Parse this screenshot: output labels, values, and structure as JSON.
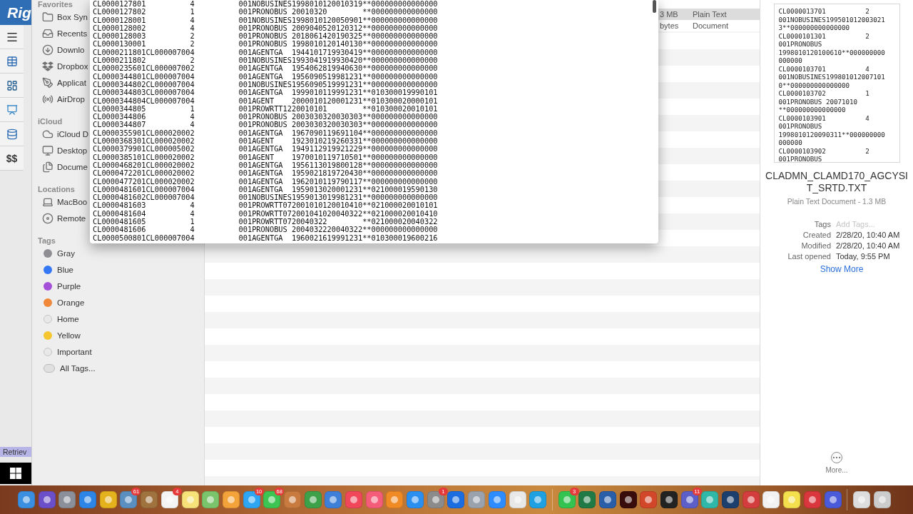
{
  "left_strip": {
    "logo": "Rig",
    "dollar_label": "$$",
    "retrieve_label": "Retriev"
  },
  "sidebar": {
    "sections": [
      {
        "title": "Favorites",
        "items": [
          {
            "label": "Box Syn",
            "kind": "folder"
          },
          {
            "label": "Recents",
            "kind": "recents"
          },
          {
            "label": "Downlo",
            "kind": "download"
          },
          {
            "label": "Dropbox",
            "kind": "dropbox"
          },
          {
            "label": "Applicat",
            "kind": "apps"
          },
          {
            "label": "AirDrop",
            "kind": "airdrop"
          }
        ]
      },
      {
        "title": "iCloud",
        "items": [
          {
            "label": "iCloud D",
            "kind": "cloud"
          },
          {
            "label": "Desktop",
            "kind": "desktop"
          },
          {
            "label": "Docume",
            "kind": "document"
          }
        ]
      },
      {
        "title": "Locations",
        "items": [
          {
            "label": "MacBoo",
            "kind": "laptop"
          },
          {
            "label": "Remote",
            "kind": "disc"
          }
        ]
      },
      {
        "title": "Tags",
        "items": [
          {
            "label": "Gray",
            "kind": "tag",
            "color": "#8e8e93"
          },
          {
            "label": "Blue",
            "kind": "tag",
            "color": "#3478f6"
          },
          {
            "label": "Purple",
            "kind": "tag",
            "color": "#a550d8"
          },
          {
            "label": "Orange",
            "kind": "tag",
            "color": "#f0883a"
          },
          {
            "label": "Home",
            "kind": "tag-empty"
          },
          {
            "label": "Yellow",
            "kind": "tag",
            "color": "#f5c62f"
          },
          {
            "label": "Important",
            "kind": "tag-empty"
          },
          {
            "label": "All Tags...",
            "kind": "all-tags"
          }
        ]
      }
    ]
  },
  "file_list": {
    "rows": [
      {
        "size": "3 MB",
        "file_kind": "Plain Text",
        "selected": true
      },
      {
        "size": "bytes",
        "file_kind": "Document",
        "selected": false
      }
    ]
  },
  "quick_look": {
    "lines": [
      "CL0000127801          4          001NOBUSINES1998010120010319**000000000000000",
      "CL0000127802          1          001PRONOBUS 20010320        **000000000000000",
      "CL0000128001          4          001NOBUSINES1998010120050901**000000000000000",
      "CL0000128002          4          001PRONOBUS 2009040520120312**000000000000000",
      "CL0000128003          2          001PRONOBUS 2018061420190325**000000000000000",
      "CL0000130001          2          001PRONOBUS 1998010120140130**000000000000000",
      "CL0000211801CL000007004          001AGENTGA  1944101719930419**000000000000000",
      "CL0000211802          2          001NOBUSINES1993041919930420**000000000000000",
      "CL0000235601CL000007002          001AGENTGA  1954062819940630**000000000000000",
      "CL0000344801CL000007004          001AGENTGA  1956090519981231**000000000000000",
      "CL0000344802CL000007004          001NOBUSINES1956090519991231**000000000000000",
      "CL0000344803CL000007004          001AGENTGA  1999010119991231**010300019990101",
      "CL0000344804CL000007004          001AGENT    2000010120001231**010300020000101",
      "CL0000344805          1          001PROWRTT1220010101        **010300020010101",
      "CL0000344806          4          001PRONOBUS 2003030320030303**000000000000000",
      "CL0000344807          4          001PRONOBUS 2003030320030303**000000000000000",
      "CL0000355901CL000020002          001AGENTGA  1967090119691104**000000000000000",
      "CL0000368301CL000020002          001AGENT    1923010219260331**000000000000000",
      "CL0000379901CL000005002          001AGENTGA  1949112919921229**000000000000000",
      "CL0000385101CL000020002          001AGENT    1970010119710501**000000000000000",
      "CL0000468201CL000020002          001AGENTGA  1956113019800128**000000000000000",
      "CL0000472201CL000020002          001AGENTGA  1959021819720430**000000000000000",
      "CL0000477201CL000020002          001AGENTGA  1962010119790117**000000000000000",
      "CL0000481601CL000007004          001AGENTGA  1959013020001231**021000019590130",
      "CL0000481602CL000007004          001NOBUSINES1959013019981231**000000000000000",
      "CL0000481603          4          001PROWRTT072001010120010410**021000020010101",
      "CL0000481604          4          001PROWRTT072001041020040322**021000020010410",
      "CL0000481605          1          001PROWRTT0720040322        **021000020040322",
      "CL0000481606          4          001PRONOBUS 2004032220040322**000000000000000",
      "CL0000500801CL000007004          001AGENTGA  1960021619991231**010300019600216"
    ]
  },
  "preview": {
    "lines": [
      "CL0000013701          2",
      "001NOBUSINES199501012003021",
      "3**000000000000000",
      "CL0000101301          2",
      "001PRONOBUS",
      "1998010120100610**000000000",
      "000000",
      "CL0000103701          4",
      "001NOBUSINES199801012007101",
      "0**000000000000000",
      "CL0000103702          1",
      "001PRONOBUS 20071010",
      "**000000000000000",
      "CL0000103901          4",
      "001PRONOBUS",
      "1998010120090311**000000000",
      "000000",
      "CL0000103902          2",
      "001PRONOBUS"
    ],
    "filename": "CLADMN_CLAMD170_AGCYSIT_SRTD.TXT",
    "subtitle": "Plain Text Document - 1.3 MB",
    "meta": [
      {
        "label": "Tags",
        "placeholder": "Add Tags..."
      },
      {
        "label": "Created",
        "value": "2/28/20, 10:40 AM"
      },
      {
        "label": "Modified",
        "value": "2/28/20, 10:40 AM"
      },
      {
        "label": "Last opened",
        "value": "Today, 9:55 PM"
      }
    ],
    "show_more": "Show More",
    "more": "More..."
  },
  "dock": {
    "items": [
      {
        "kind": "app"
      },
      {
        "kind": "app"
      },
      {
        "kind": "app"
      },
      {
        "kind": "app"
      },
      {
        "kind": "app"
      },
      {
        "kind": "app",
        "badge": "61"
      },
      {
        "kind": "app"
      },
      {
        "kind": "app",
        "badge": "4"
      },
      {
        "kind": "app"
      },
      {
        "kind": "app"
      },
      {
        "kind": "app"
      },
      {
        "kind": "app",
        "badge": "10"
      },
      {
        "kind": "app",
        "badge": "68"
      },
      {
        "kind": "app"
      },
      {
        "kind": "app"
      },
      {
        "kind": "app"
      },
      {
        "kind": "app"
      },
      {
        "kind": "app"
      },
      {
        "kind": "app"
      },
      {
        "kind": "app"
      },
      {
        "kind": "app",
        "badge": "1"
      },
      {
        "kind": "app"
      },
      {
        "kind": "app"
      },
      {
        "kind": "app"
      },
      {
        "kind": "app"
      },
      {
        "kind": "app"
      },
      {
        "kind": "separator"
      },
      {
        "kind": "app",
        "badge": "3"
      },
      {
        "kind": "app"
      },
      {
        "kind": "app"
      },
      {
        "kind": "app"
      },
      {
        "kind": "app"
      },
      {
        "kind": "app"
      },
      {
        "kind": "app",
        "badge": "11"
      },
      {
        "kind": "app"
      },
      {
        "kind": "app"
      },
      {
        "kind": "app"
      },
      {
        "kind": "app"
      },
      {
        "kind": "app"
      },
      {
        "kind": "app"
      },
      {
        "kind": "app"
      },
      {
        "kind": "separator"
      },
      {
        "kind": "app"
      },
      {
        "kind": "app"
      }
    ]
  }
}
